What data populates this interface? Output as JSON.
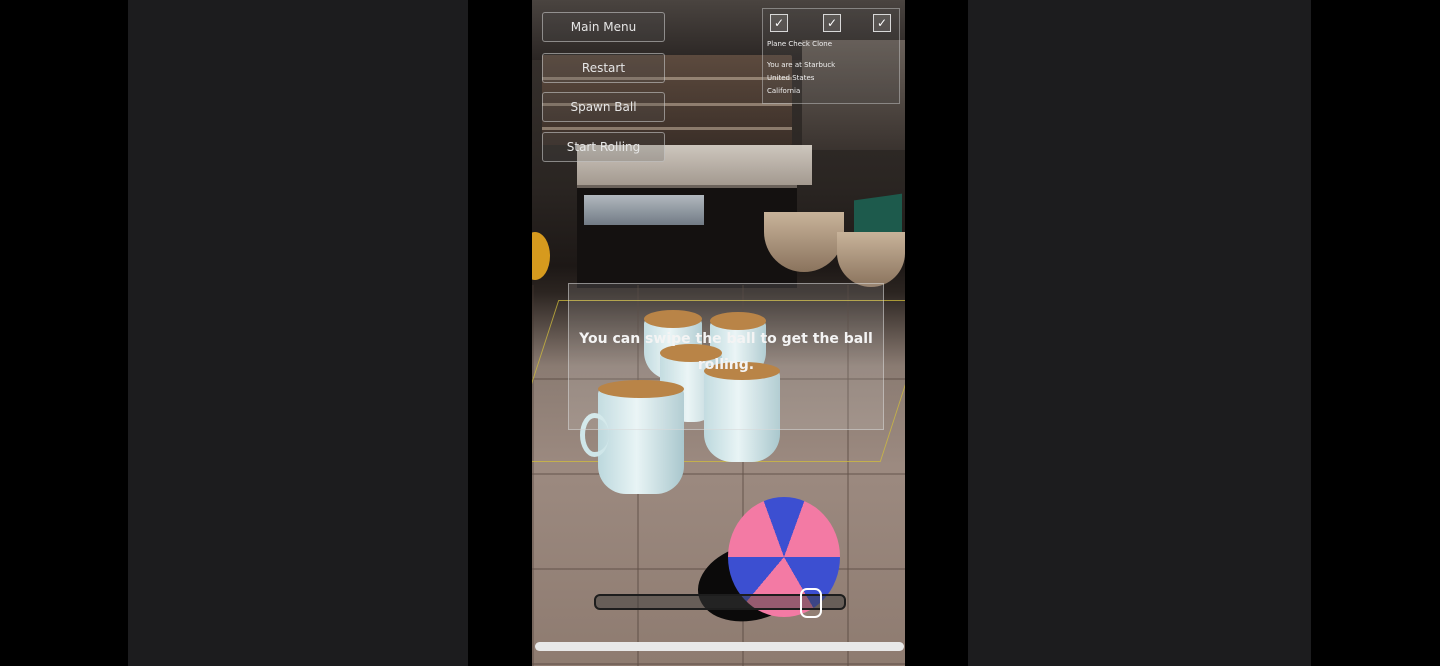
{
  "menu": {
    "main_menu": "Main Menu",
    "restart": "Restart",
    "spawn_ball": "Spawn Ball",
    "start_rolling": "Start Rolling"
  },
  "checkboxes": [
    "✓",
    "✓",
    "✓"
  ],
  "status": {
    "lines": [
      "Plane Check  Clone",
      "You are at Starbuck",
      "United States",
      "California"
    ]
  },
  "instruction": "You can swipe the ball to get the ball rolling.",
  "power_slider": {
    "level": 0.86
  },
  "colors": {
    "ball_pink": "#f37aa4",
    "ball_blue": "#3c4fd1",
    "cup": "#e8f4f5",
    "caramel": "#b0732e"
  }
}
